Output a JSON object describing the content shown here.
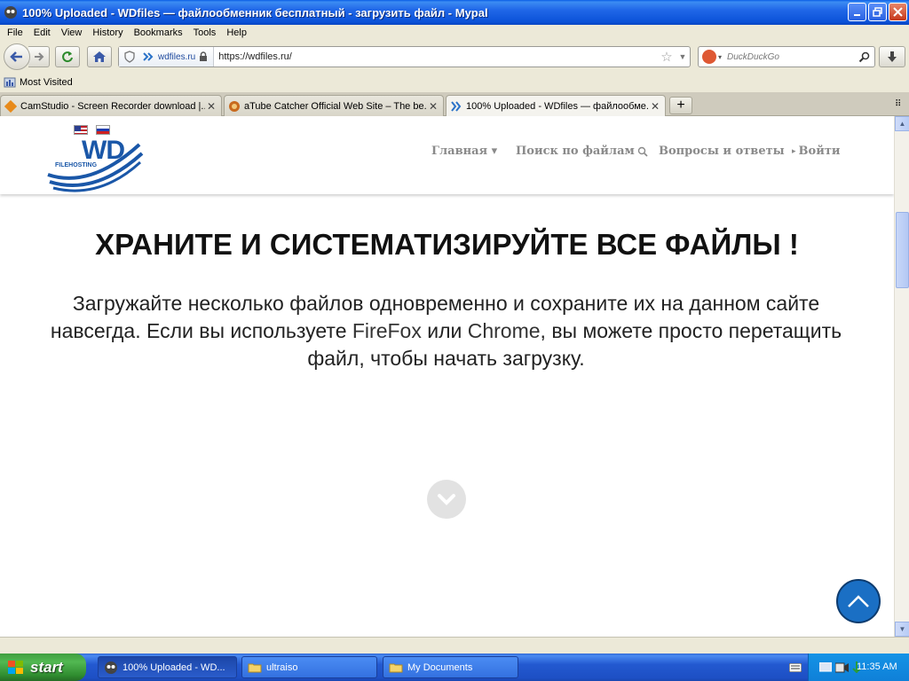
{
  "window": {
    "title": "100% Uploaded - WDfiles — файлообменник бесплатный - загрузить файл - Mypal"
  },
  "menu": [
    "File",
    "Edit",
    "View",
    "History",
    "Bookmarks",
    "Tools",
    "Help"
  ],
  "navbar": {
    "identity_domain": "wdfiles.ru",
    "url": "https://wdfiles.ru/",
    "search_placeholder": "DuckDuckGo"
  },
  "bookmarks": {
    "most_visited": "Most Visited"
  },
  "tabs": [
    {
      "label": "CamStudio - Screen Recorder download |...",
      "active": false
    },
    {
      "label": "aTube Catcher Official Web Site – The be...",
      "active": false
    },
    {
      "label": "100% Uploaded - WDfiles — файлообме...",
      "active": true
    }
  ],
  "site": {
    "logo_text": "WD",
    "logo_subtext": "FILEHOSTING",
    "nav": {
      "main": "Главная ▾",
      "search": "Поиск по файлам",
      "faq": "Вопросы и ответы",
      "login": "Войти"
    },
    "hero_title": "ХРАНИТЕ И СИСТЕМАТИЗИРУЙТЕ ВСЕ ФАЙЛЫ !",
    "hero_text_1": "Загружайте несколько файлов одновременно и сохраните их на данном сайте навсегда. Если вы используете ",
    "hero_firefox": "FireFox",
    "hero_text_2": " или ",
    "hero_chrome": "Chrome",
    "hero_text_3": ", вы можете просто перетащить файл, чтобы начать загрузку."
  },
  "taskbar": {
    "start_label": "start",
    "items": [
      {
        "label": "100% Uploaded - WD...",
        "active": true
      },
      {
        "label": "ultraiso",
        "active": false
      },
      {
        "label": "My Documents",
        "active": false
      }
    ],
    "clock": "11:35 AM"
  },
  "colors": {
    "accent_blue": "#1a6fc4",
    "logo_blue": "#1a57a8",
    "nav_grey": "#8a8a8a"
  }
}
